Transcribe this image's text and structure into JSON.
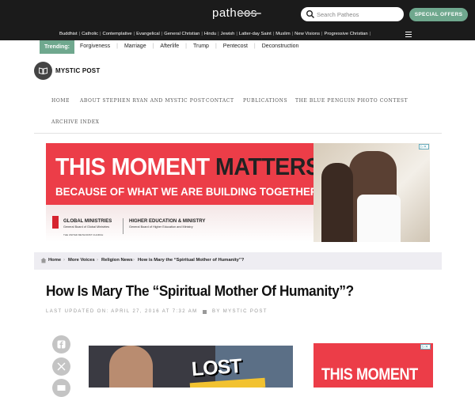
{
  "header": {
    "logo": "patheos",
    "search_placeholder": "Search Patheos",
    "offers_label": "SPECIAL OFFERS"
  },
  "categories": [
    "Buddhist",
    "Catholic",
    "Contemplative",
    "Evangelical",
    "General Christian",
    "Hindu",
    "Jewish",
    "Latter-day Saint",
    "Muslim",
    "New Visions",
    "Progressive Christian"
  ],
  "trending": {
    "label": "Trending:",
    "links": [
      "Forgiveness",
      "Marriage",
      "Afterlife",
      "Trump",
      "Pentecost",
      "Deconstruction"
    ]
  },
  "blog": {
    "name": "MYSTIC POST"
  },
  "nav": {
    "home": "HOME",
    "about": "ABOUT STEPHEN RYAN AND MYSTIC POST",
    "contact": "CONTACT",
    "publications": "PUBLICATIONS",
    "contest": "THE BLUE PENGUIN PHOTO CONTEST",
    "archive": "ARCHIVE INDEX"
  },
  "ad_banner": {
    "headline_light": "THIS MOMENT",
    "headline_dark": "MATTERS",
    "subhead": "BECAUSE OF WHAT WE ARE BUILDING TOGETHER.",
    "org1_title": "GLOBAL MINISTRIES",
    "org1_sub": "General Board of Global Ministries",
    "org1_church": "THE UNITED METHODIST CHURCH",
    "org2_title": "HIGHER EDUCATION & MINISTRY",
    "org2_sub": "General Board of Higher Education and Ministry",
    "accent": "#ec3d48"
  },
  "breadcrumb": [
    "Home",
    "More Voices",
    "Religion News",
    "How is Mary the “Spiritual Mother of Humanity”?"
  ],
  "article": {
    "title": "How Is Mary The “Spiritual Mother Of Humanity”?",
    "updated": "LAST UPDATED ON: APRIL 27, 2016 AT 7:32 AM",
    "author": "BY MYSTIC POST"
  },
  "video": {
    "headline": "LOST"
  },
  "ad_side": {
    "headline": "THIS MOMENT"
  },
  "colors": {
    "topbar": "#1b1b1b",
    "accent_green": "#6fa88e",
    "ad_red": "#ec3d48"
  }
}
